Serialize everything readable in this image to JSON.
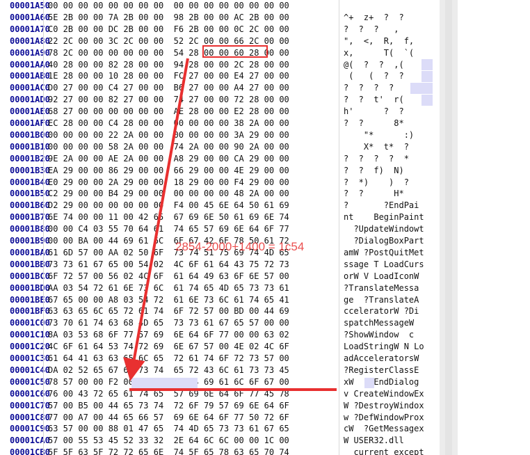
{
  "rows": [
    {
      "addr": "00001A50",
      "hex": "00 00 00 00 00 00 00 00  00 00 00 00 00 00 00 00",
      "ascii": ""
    },
    {
      "addr": "00001A60",
      "hex": "5E 2B 00 00 7A 2B 00 00  98 2B 00 00 AC 2B 00 00",
      "ascii": "^+  z+  ?  ?"
    },
    {
      "addr": "00001A70",
      "hex": "C0 2B 00 00 DC 2B 00 00  F6 2B 00 00 0C 2C 00 00",
      "ascii": "?  ?  ?   ,"
    },
    {
      "addr": "00001A80",
      "hex": "22 2C 00 00 3C 2C 00 00  52 2C 00 00 66 2C 00 00",
      "ascii": "\",  <,  R,  f,"
    },
    {
      "addr": "00001A90",
      "hex": "78 2C 00 00 00 00 00 00  54 28 00 00 60 28 00 00",
      "ascii": "x,      T(  `("
    },
    {
      "addr": "00001AA0",
      "hex": "40 28 00 00 82 28 00 00  94 28 00 00 2C 28 00 00",
      "ascii": "@(  ?  ?  ,("
    },
    {
      "addr": "00001AB0",
      "hex": "1E 28 00 00 10 28 00 00  FC 27 00 00 E4 27 00 00",
      "ascii": " (   (  ?  ?"
    },
    {
      "addr": "00001AC0",
      "hex": "D0 27 00 00 C4 27 00 00  B6 27 00 00 A4 27 00 00",
      "ascii": "?  ?  ?  ?"
    },
    {
      "addr": "00001AD0",
      "hex": "92 27 00 00 82 27 00 00  74 27 00 00 72 28 00 00",
      "ascii": "?  ?  t'  r("
    },
    {
      "addr": "00001AE0",
      "hex": "68 27 00 00 00 00 00 00  AE 28 00 00 E2 28 00 00",
      "ascii": "h'      ?  ?"
    },
    {
      "addr": "00001AF0",
      "hex": "EC 28 00 00 C4 28 00 00  00 00 00 00 38 2A 00 00",
      "ascii": "?  ?      8*"
    },
    {
      "addr": "00001B00",
      "hex": "00 00 00 00 22 2A 00 00  00 00 00 00 3A 29 00 00",
      "ascii": "    \"*      :)"
    },
    {
      "addr": "00001B10",
      "hex": "00 00 00 00 58 2A 00 00  74 2A 00 00 90 2A 00 00",
      "ascii": "    X*  t*  ?"
    },
    {
      "addr": "00001B20",
      "hex": "9E 2A 00 00 AE 2A 00 00  A8 29 00 00 CA 29 00 00",
      "ascii": "?  ?  ?  ?  *"
    },
    {
      "addr": "00001B30",
      "hex": "EA 29 00 00 86 29 00 00  66 29 00 00 4E 29 00 00",
      "ascii": "?  ?  f)  N)"
    },
    {
      "addr": "00001B40",
      "hex": "E0 29 00 00 2A 29 00 00  18 29 00 00 F4 29 00 00",
      "ascii": "?  *)    )  ?"
    },
    {
      "addr": "00001B50",
      "hex": "C2 29 00 00 B4 29 00 00  00 00 00 00 48 2A 00 00",
      "ascii": "?  ?      H*"
    },
    {
      "addr": "00001B60",
      "hex": "D2 29 00 00 00 00 00 00  F4 00 45 6E 64 50 61 69",
      "ascii": "?       ?EndPai"
    },
    {
      "addr": "00001B70",
      "hex": "6E 74 00 00 11 00 42 65  67 69 6E 50 61 69 6E 74",
      "ascii": "nt    BeginPaint"
    },
    {
      "addr": "00001B80",
      "hex": "00 00 C4 03 55 70 64 61  74 65 57 69 6E 64 6F 77",
      "ascii": "  ?UpdateWindowt"
    },
    {
      "addr": "00001B90",
      "hex": "00 00 BA 00 44 69 61 6C  6F 67 42 6F 78 50 61 72",
      "ascii": "  ?DialogBoxPart"
    },
    {
      "addr": "00001BA0",
      "hex": "61 6D 57 00 AA 02 50 6F  73 74 51 75 69 74 4D 65",
      "ascii": "amW ?PostQuitMet"
    },
    {
      "addr": "00001BB0",
      "hex": "73 73 61 67 65 00 54 02  4C 6F 61 64 43 75 72 73",
      "ascii": "ssage T LoadCurs"
    },
    {
      "addr": "00001BC0",
      "hex": "6F 72 57 00 56 02 4C 6F  61 64 49 63 6F 6E 57 00",
      "ascii": "orW V LoadIconW"
    },
    {
      "addr": "00001BD0",
      "hex": "AA 03 54 72 61 6E 73 6C  61 74 65 4D 65 73 73 61",
      "ascii": "?TranslateMessa"
    },
    {
      "addr": "00001BE0",
      "hex": "67 65 00 00 A8 03 54 72  61 6E 73 6C 61 74 65 41",
      "ascii": "ge  ?TranslateA"
    },
    {
      "addr": "00001BF0",
      "hex": "63 63 65 6C 65 72 61 74  6F 72 57 00 BD 00 44 69",
      "ascii": "cceleratorW ?Di"
    },
    {
      "addr": "00001C00",
      "hex": "73 70 61 74 63 68 4D 65  73 73 61 67 65 57 00 00",
      "ascii": "spatchMessageW"
    },
    {
      "addr": "00001C10",
      "hex": "8A 03 53 68 6F 77 57 69  6E 64 6F 77 00 00 63 02",
      "ascii": "?ShowWindow  c"
    },
    {
      "addr": "00001C20",
      "hex": "4C 6F 61 64 53 74 72 69  6E 67 57 00 4E 02 4C 6F",
      "ascii": "LoadStringW N Lo"
    },
    {
      "addr": "00001C30",
      "hex": "61 64 41 63 63 65 6C 65  72 61 74 6F 72 73 57 00",
      "ascii": "adAcceleratorsW"
    },
    {
      "addr": "00001C40",
      "hex": "DA 02 52 65 67 69 73 74  65 72 43 6C 61 73 73 45",
      "ascii": "?RegisterClassE"
    },
    {
      "addr": "00001C50",
      "hex": "78 57 00 00 F2 00 45 6E  64 44 69 61 6C 6F 67 00",
      "ascii": "xW  ? EndDialog"
    },
    {
      "addr": "00001C60",
      "hex": "76 00 43 72 65 61 74 65  57 69 6E 64 6F 77 45 78",
      "ascii": "v CreateWindowEx"
    },
    {
      "addr": "00001C70",
      "hex": "57 00 B5 00 44 65 73 74  72 6F 79 57 69 6E 64 6F",
      "ascii": "W ?DestroyWindox"
    },
    {
      "addr": "00001C80",
      "hex": "77 00 A7 00 44 65 66 57  69 6E 64 6F 77 50 72 6F",
      "ascii": "w ?DefWindowProx"
    },
    {
      "addr": "00001C90",
      "hex": "63 57 00 00 88 01 47 65  74 4D 65 73 73 61 67 65",
      "ascii": "cW  ?GetMessagex"
    },
    {
      "addr": "00001CA0",
      "hex": "57 00 55 53 45 52 33 32  2E 64 6C 6C 00 00 1C 00",
      "ascii": "W USER32.dll"
    },
    {
      "addr": "00001CB0",
      "hex": "5F 5F 63 5F 72 72 65 6E  74 5F 65 78 63 65 70 74",
      "ascii": "__current_except"
    }
  ],
  "annotation": {
    "text": "2854-2000+1400 = 1c54"
  },
  "colors": {
    "address": "#0a0a96",
    "highlight": "#dcdcf8",
    "annotation_red": "#e83030",
    "scrollbar": "#ececec"
  }
}
